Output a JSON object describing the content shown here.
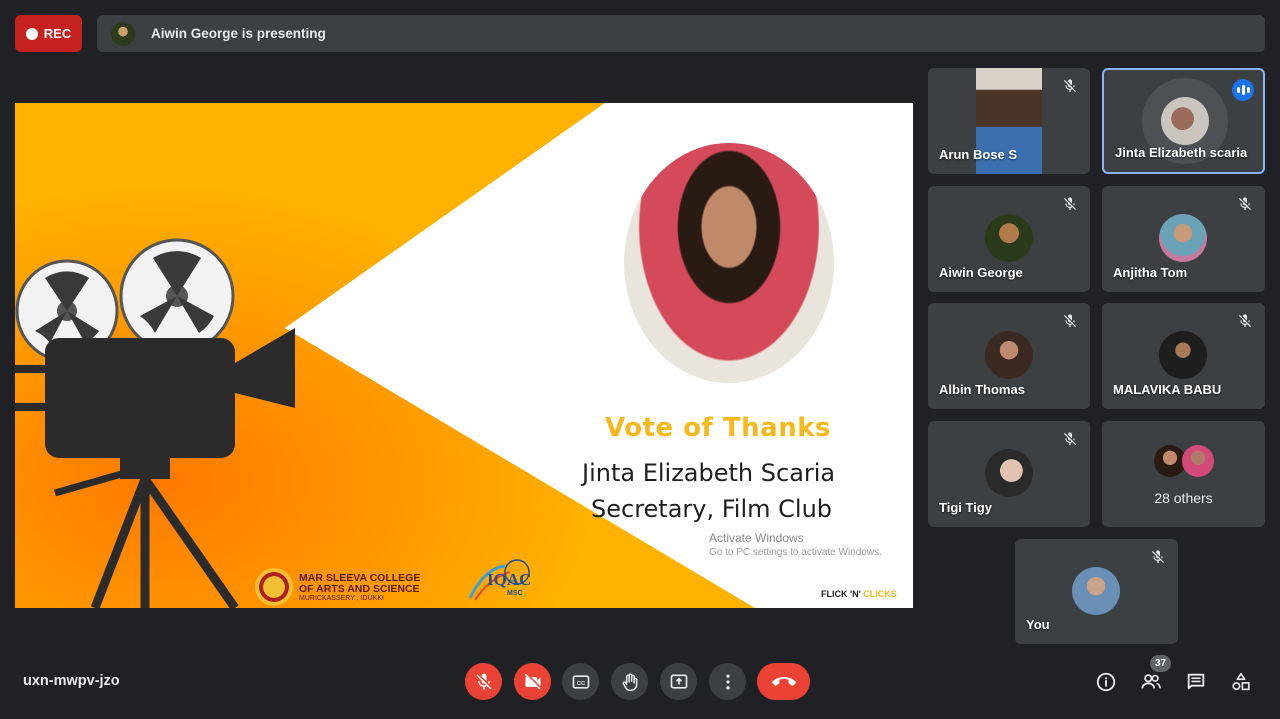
{
  "recording": {
    "label": "REC"
  },
  "presenting": {
    "text": "Aiwin George is presenting"
  },
  "slide": {
    "heading": "Vote of Thanks",
    "name": "Jinta Elizabeth Scaria",
    "role": "Secretary, Film Club",
    "activate_title": "Activate Windows",
    "activate_sub": "Go to PC settings to activate Windows.",
    "college_line1": "MAR SLEEVA COLLEGE",
    "college_line2": "OF ARTS AND SCIENCE",
    "college_line3": "MURICKASSERY , IDUKKI",
    "iqac_label": "IQAC",
    "iqac_sub": "MSC",
    "flick_a": "FLICK 'N' ",
    "flick_b": "CLICKS"
  },
  "participants": [
    {
      "name": "Arun Bose S",
      "muted": true
    },
    {
      "name": "Jinta Elizabeth scaria",
      "muted": false,
      "speaking": true
    },
    {
      "name": "Aiwin George",
      "muted": true
    },
    {
      "name": "Anjitha Tom",
      "muted": true
    },
    {
      "name": "Albin Thomas",
      "muted": true
    },
    {
      "name": "MALAVIKA BABU",
      "muted": true
    },
    {
      "name": "Tigi Tigy",
      "muted": true
    },
    {
      "name": "You",
      "muted": true
    }
  ],
  "others": {
    "label": "28 others"
  },
  "bottom": {
    "meeting_code": "uxn-mwpv-jzo",
    "people_count": "37"
  },
  "colors": {
    "background": "#202124",
    "tile": "#3c4043",
    "danger": "#ea4335",
    "accent": "#8ab4f8",
    "slide_yellow": "#f6b81b"
  },
  "icons": [
    "mic-off-icon",
    "camera-off-icon",
    "captions-icon",
    "raise-hand-icon",
    "present-screen-icon",
    "more-options-icon",
    "end-call-icon",
    "info-icon",
    "people-icon",
    "chat-icon",
    "activities-icon"
  ]
}
